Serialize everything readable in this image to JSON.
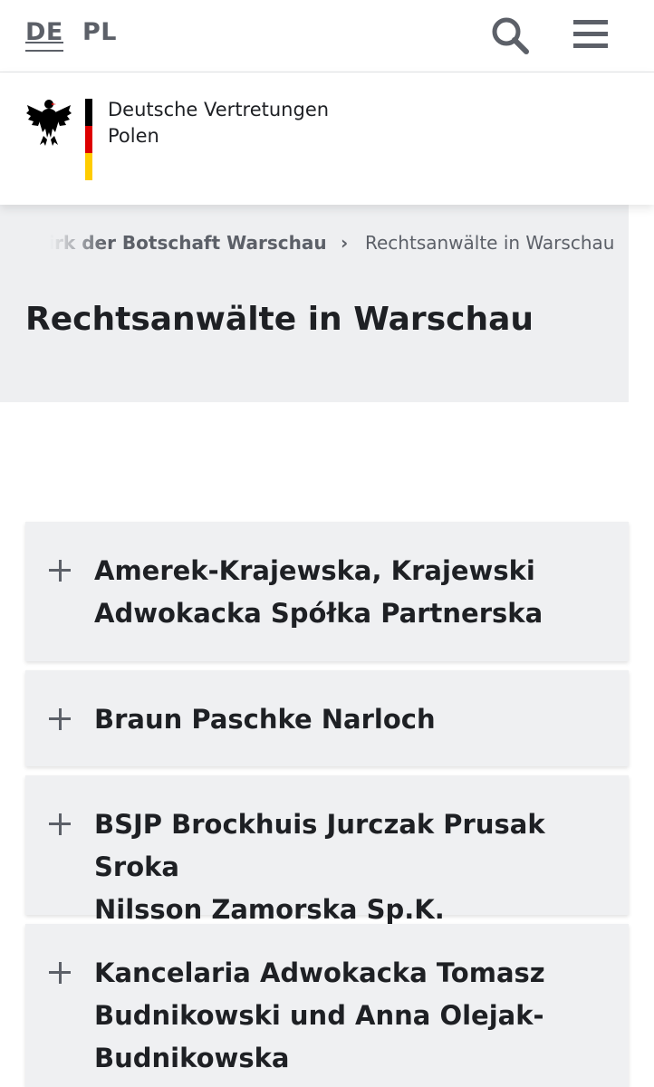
{
  "topbar": {
    "lang_de": "DE",
    "lang_pl": "PL",
    "search_icon": "search-icon",
    "menu_icon": "hamburger-menu-icon"
  },
  "logo": {
    "icon": "federal-eagle-icon",
    "org_line1": "Deutsche Vertretungen",
    "org_line2": "Polen",
    "flag_colors": [
      "#000000",
      "#dd0000",
      "#ffcc00"
    ]
  },
  "breadcrumb": {
    "parent": "ezirk der Botschaft Warschau",
    "separator": "›",
    "current": "Rechtsanwälte in Warschau"
  },
  "page": {
    "title": "Rechtsanwälte in Warschau"
  },
  "accordion": [
    {
      "line1": "Amerek-Krajewska, Krajewski",
      "line2": "Adwokacka Spółka Partnerska",
      "line3": ""
    },
    {
      "line1": "Braun Paschke Narloch",
      "line2": "",
      "line3": ""
    },
    {
      "line1": "BSJP Brockhuis Jurczak Prusak Sroka",
      "line2": "Nilsson Zamorska Sp.K.",
      "line3": ""
    },
    {
      "line1": "Kancelaria Adwokacka Tomasz",
      "line2": "Budnikowski und Anna Olejak-",
      "line3": "Budnikowska"
    }
  ],
  "colors": {
    "accent_grey": "#5c6068",
    "panel_bg": "#eeeff1",
    "text": "#1e2024"
  }
}
